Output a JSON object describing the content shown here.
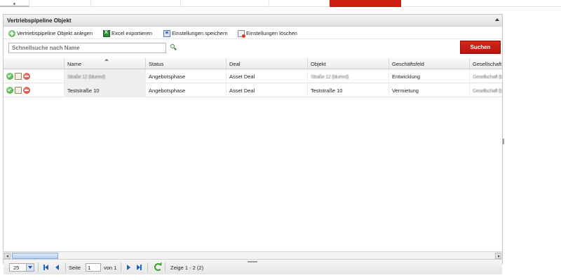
{
  "panel": {
    "title": "Vertriebspipeline Objekt"
  },
  "toolbar": {
    "add_label": "Vertriebspipeline Objekt anlegen",
    "export_label": "Excel exportieren",
    "save_settings_label": "Einstellungen speichern",
    "delete_settings_label": "Einstellungen löschen"
  },
  "search": {
    "placeholder": "Schnellsuche nach Name",
    "button_label": "Suchen"
  },
  "grid": {
    "columns": [
      "",
      "Name",
      "Status",
      "Deal",
      "Objekt",
      "Geschäftsfeld",
      "Gesellschaft"
    ],
    "rows": [
      {
        "name": "Straße 12 (blurred)",
        "status": "Angebotsphase",
        "deal": "Asset Deal",
        "objekt": "Straße 12 (blurred)",
        "geschaeftsfeld": "Entwicklung",
        "gesellschaft": "Gesellschaft (blurred)"
      },
      {
        "name": "Teststraße 10",
        "status": "Angebotsphase",
        "deal": "Asset Deal",
        "objekt": "Teststraße 10",
        "geschaeftsfeld": "Vermietung",
        "gesellschaft": "Gesellschaft (blurred)"
      }
    ]
  },
  "pager": {
    "page_size": "25",
    "page_label": "Seite",
    "page_value": "1",
    "of_label": "von 1",
    "display_label": "Zeige 1 - 2 (2)"
  },
  "colors": {
    "accent_red": "#cc1d10",
    "panel_border": "#c4c4c4"
  }
}
